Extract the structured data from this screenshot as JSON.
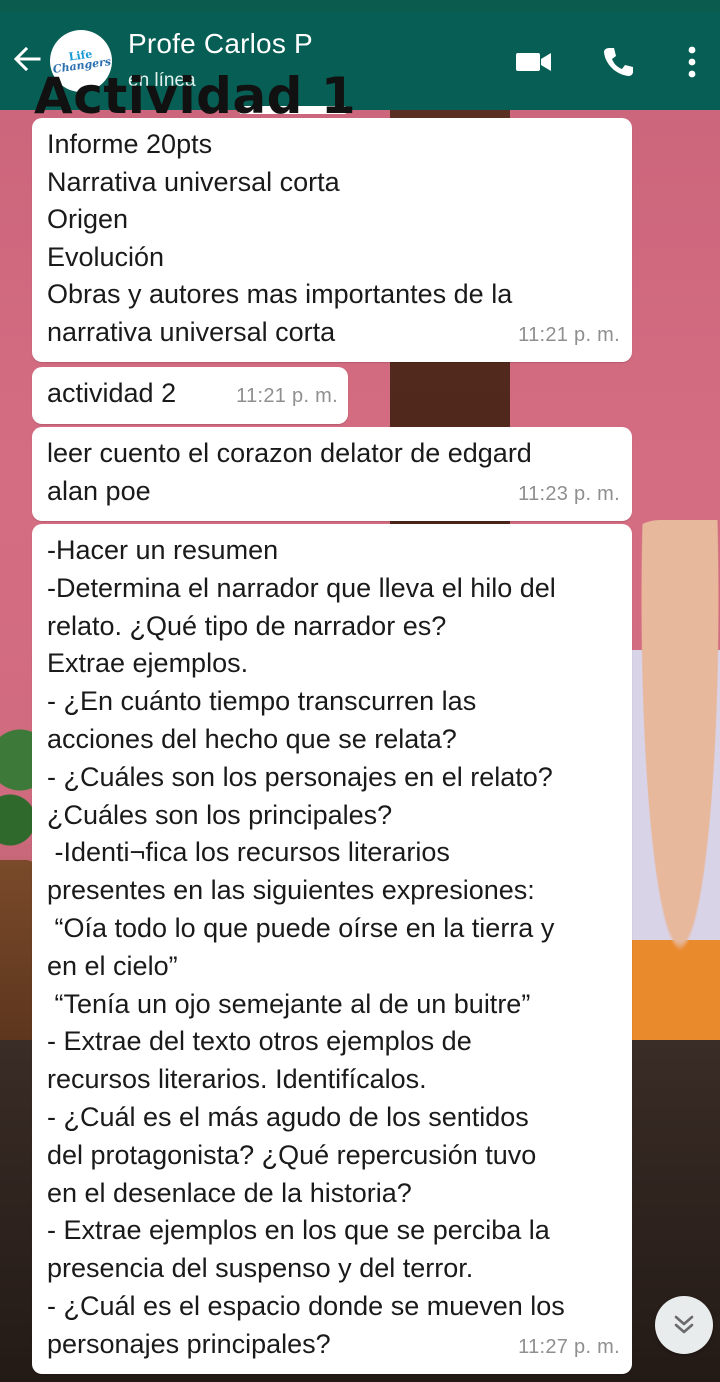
{
  "header": {
    "contact_name": "Profe Carlos P",
    "contact_status": "en línea",
    "overlay_title": "Actividad 1",
    "avatar_logo_line1": "Life",
    "avatar_logo_line2": "Changers",
    "colors": {
      "header_bg": "#075e54",
      "header_text": "#ffffff",
      "bubble_bg": "#ffffff",
      "timestamp": "#8f8f8f"
    },
    "icons": [
      "back-arrow-icon",
      "video-call-icon",
      "phone-call-icon",
      "more-options-icon"
    ]
  },
  "messages": [
    {
      "text": "Informe 20pts\nNarrativa universal corta\nOrigen\nEvolución\nObras y autores mas importantes de la\nnarrativa universal corta",
      "time": "11:21 p. m."
    },
    {
      "text": "actividad 2",
      "time": "11:21 p. m."
    },
    {
      "text": "leer cuento el corazon delator de edgard\nalan poe",
      "time": "11:23 p. m."
    },
    {
      "text": "-Hacer un resumen\n-Determina el narrador que lleva el hilo del\nrelato. ¿Qué tipo de narrador es?\nExtrae ejemplos.\n- ¿En cuánto tiempo transcurren las\nacciones del hecho que se relata?\n- ¿Cuáles son los personajes en el relato?\n¿Cuáles son los principales?\n -Identi¬fica los recursos literarios\npresentes en las siguientes expresiones:\n “Oía todo lo que puede oírse en la tierra y\nen el cielo”\n “Tenía un ojo semejante al de un buitre”\n- Extrae del texto otros ejemplos de\nrecursos literarios. Identifícalos.\n- ¿Cuál es el más agudo de los sentidos\ndel protagonista? ¿Qué repercusión tuvo\nen el desenlace de la historia?\n- Extrae ejemplos en los que se perciba la\npresencia del suspenso y del terror.\n- ¿Cuál es el espacio donde se mueven los\npersonajes principales?",
      "time": "11:27 p. m."
    }
  ],
  "scroll_button_icon": "double-chevron-down-icon"
}
